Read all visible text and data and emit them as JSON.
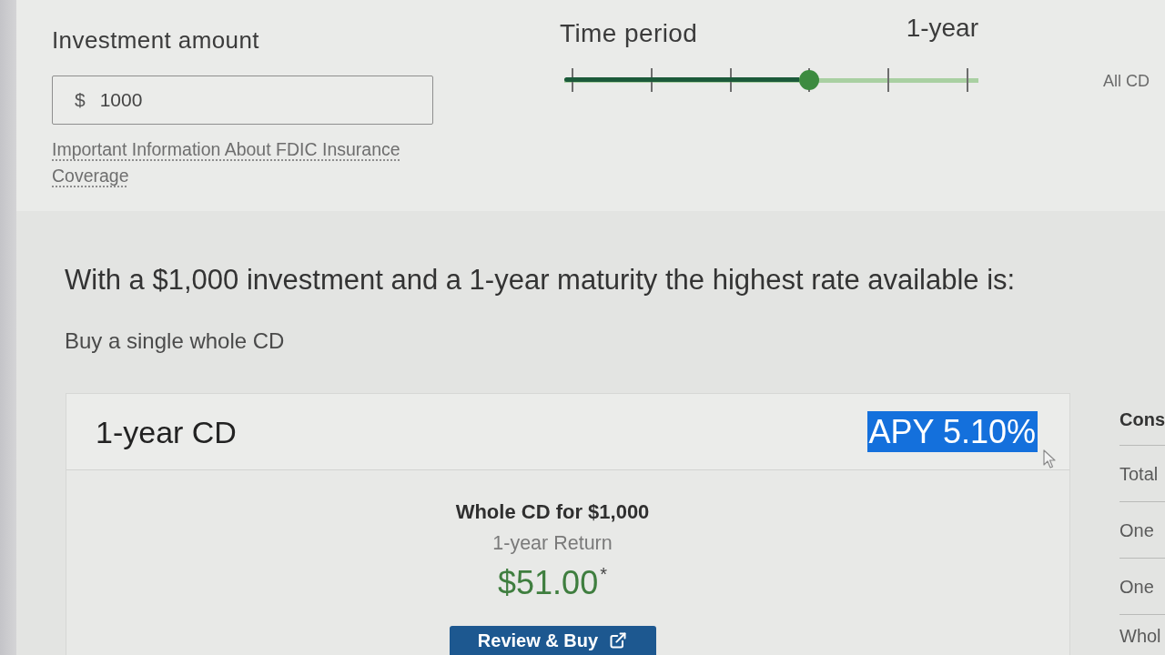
{
  "investment": {
    "label": "Investment amount",
    "prefix": "$",
    "value": "1000",
    "link": "Important Information About FDIC Insurance Coverage"
  },
  "time_period": {
    "label": "Time period",
    "value_label": "1-year",
    "level": 0.6
  },
  "all_cd_label": "All CD",
  "result": {
    "heading": "With a $1,000 investment and a 1-year maturity the highest rate available is:",
    "subheading": "Buy a single whole CD"
  },
  "cd_card": {
    "title": "1-year CD",
    "apy": {
      "text": "APY 5.10%",
      "highlighted": true
    },
    "offer_title": "Whole CD for $1,000",
    "return_label": "1-year Return",
    "return_amount": "$51.00",
    "footnote_mark": "*",
    "button": "Review & Buy"
  },
  "side_table": {
    "rows": [
      {
        "kind": "header",
        "text": "Cons"
      },
      {
        "kind": "row",
        "text": "Total"
      },
      {
        "kind": "row",
        "text": "One"
      },
      {
        "kind": "row",
        "text": "One"
      },
      {
        "kind": "row",
        "text": "Whol"
      }
    ]
  }
}
